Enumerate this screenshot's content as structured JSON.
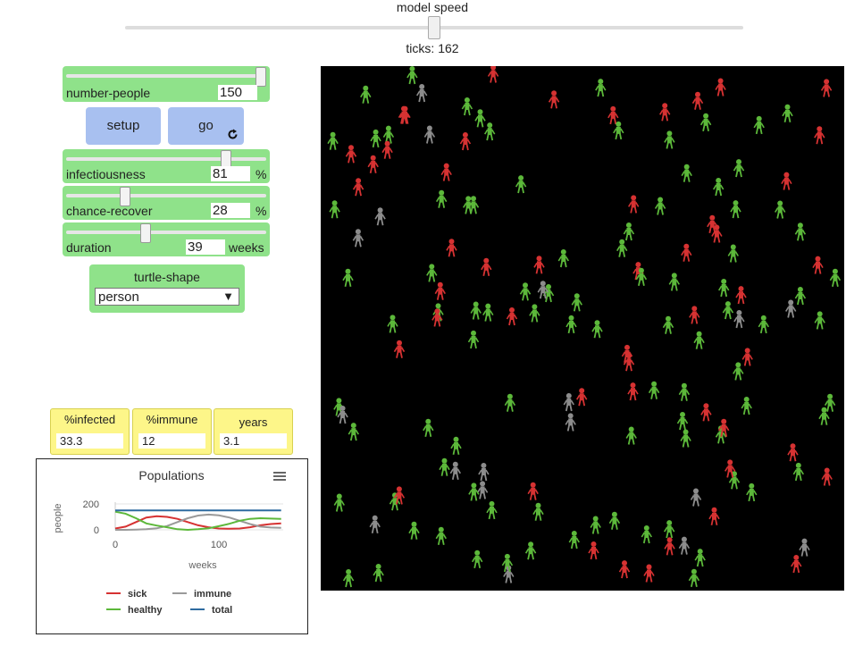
{
  "speed": {
    "label": "model speed",
    "ticks": "ticks: 162"
  },
  "sliders": {
    "number_people": {
      "label": "number-people",
      "value": "150",
      "position": 0.96
    },
    "infectiousness": {
      "label": "infectiousness",
      "value": "81",
      "unit": "%",
      "position": 0.8
    },
    "chance_recover": {
      "label": "chance-recover",
      "value": "28",
      "unit": "%",
      "position": 0.28
    },
    "duration": {
      "label": "duration",
      "value": "39",
      "unit": "weeks",
      "position": 0.4
    }
  },
  "buttons": {
    "setup": "setup",
    "go": "go",
    "go_icon": "forever-loop-icon"
  },
  "chooser": {
    "label": "turtle-shape",
    "value": "person"
  },
  "monitors": {
    "infected": {
      "label": "%infected",
      "value": "33.3"
    },
    "immune": {
      "label": "%immune",
      "value": "12"
    },
    "years": {
      "label": "years",
      "value": "3.1"
    }
  },
  "plot": {
    "menu_icon": "hamburger-menu-icon",
    "colors": {
      "sick": "#d63232",
      "immune": "#9a9a9a",
      "healthy": "#5cb83a",
      "total": "#2e6ba0"
    }
  },
  "chart_data": {
    "type": "line",
    "title": "Populations",
    "xlabel": "weeks",
    "ylabel": "people",
    "xlim": [
      0,
      162
    ],
    "ylim": [
      0,
      200
    ],
    "xticks": [
      "0",
      "100"
    ],
    "yticks": [
      "0",
      "200"
    ],
    "legend": "bottom",
    "x": [
      0,
      10,
      20,
      30,
      40,
      50,
      60,
      70,
      80,
      90,
      100,
      110,
      120,
      130,
      140,
      150,
      160
    ],
    "series": [
      {
        "name": "sick",
        "color": "#d63232",
        "values": [
          10,
          25,
          60,
          95,
          105,
          100,
          85,
          60,
          35,
          20,
          10,
          8,
          10,
          20,
          35,
          45,
          50
        ]
      },
      {
        "name": "immune",
        "color": "#9a9a9a",
        "values": [
          0,
          0,
          2,
          5,
          12,
          30,
          60,
          90,
          110,
          118,
          112,
          95,
          70,
          45,
          25,
          18,
          15
        ]
      },
      {
        "name": "healthy",
        "color": "#5cb83a",
        "values": [
          140,
          125,
          90,
          50,
          33,
          20,
          5,
          0,
          5,
          12,
          28,
          47,
          70,
          85,
          90,
          87,
          85
        ]
      },
      {
        "name": "total",
        "color": "#2e6ba0",
        "values": [
          150,
          150,
          150,
          150,
          150,
          150,
          150,
          150,
          150,
          150,
          150,
          150,
          150,
          150,
          150,
          150,
          150
        ]
      }
    ]
  },
  "world": {
    "colors": {
      "healthy": "#5cb83a",
      "sick": "#d63232",
      "immune": "#8c8c8c"
    },
    "counts": {
      "healthy": 91,
      "sick": 50,
      "immune": 18
    },
    "turtle_shape": "person"
  }
}
